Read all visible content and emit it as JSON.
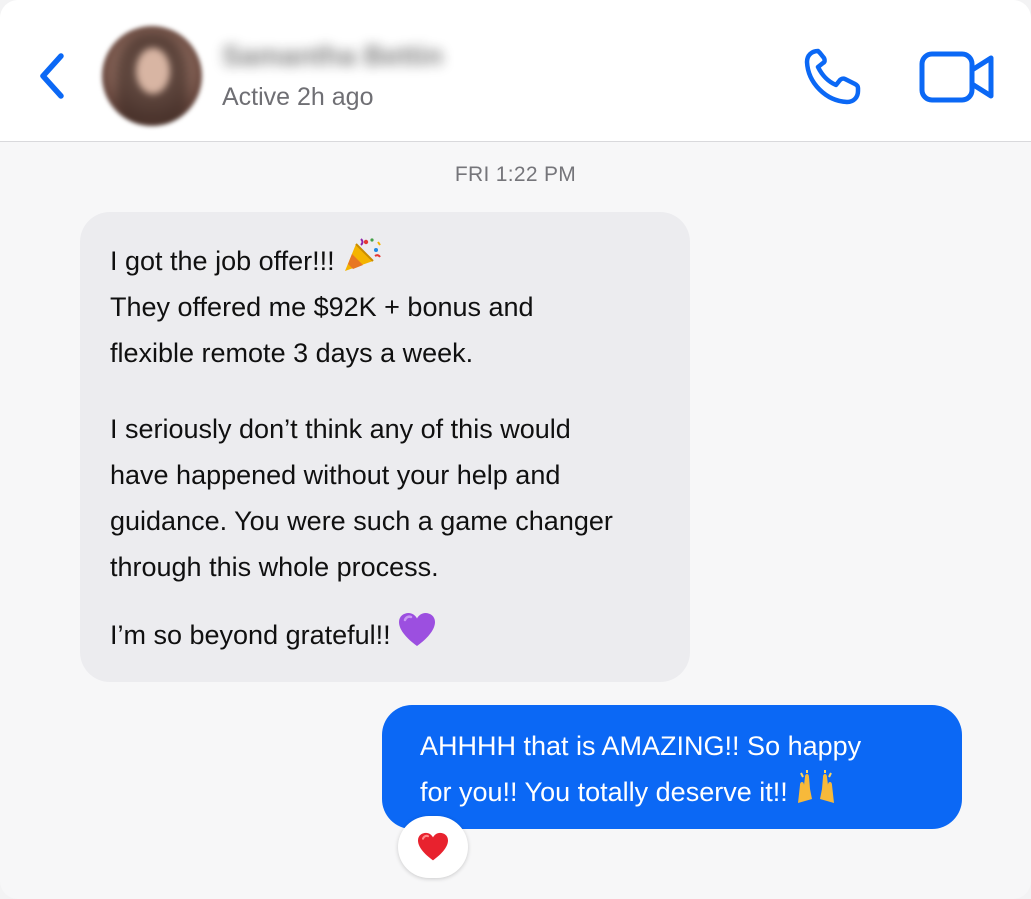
{
  "header": {
    "contact_name": "Samantha Bettin",
    "status": "Active 2h ago",
    "back_icon": "chevron-left-icon",
    "call_icon": "phone-icon",
    "video_icon": "video-camera-icon"
  },
  "conversation": {
    "timestamp": "FRI 1:22 PM",
    "incoming": {
      "line1": "I got the job offer!!!",
      "line2": "They offered me $92K + bonus and",
      "line3": "flexible remote 3 days a week.",
      "line4": "I seriously don’t think any of this would",
      "line5": "have happened without your help and",
      "line6": "guidance. You were such a game changer",
      "line7": "through this whole process.",
      "line8": "I’m so beyond grateful!!",
      "emoji1": "party-popper",
      "emoji2": "purple-heart"
    },
    "outgoing": {
      "line1": "AHHHH that is AMAZING!! So happy",
      "line2": "for you!! You totally deserve it!!",
      "emoji": "raising-hands",
      "reaction": "red-heart"
    }
  },
  "colors": {
    "accent": "#0b68f5",
    "incoming_bubble": "#ececef",
    "header_bg": "#ffffff",
    "background": "#f7f7f8"
  }
}
